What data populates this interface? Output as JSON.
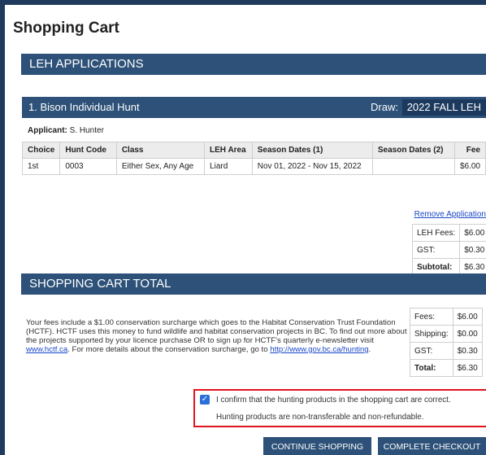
{
  "page": {
    "title": "Shopping Cart"
  },
  "leh_section": {
    "title": "LEH APPLICATIONS"
  },
  "hunt": {
    "name": "1. Bison Individual Hunt",
    "draw_label": "Draw:",
    "draw_value": "2022 FALL LEH",
    "applicant_label": "Applicant:",
    "applicant_name": "S. Hunter",
    "columns": [
      "Choice",
      "Hunt Code",
      "Class",
      "LEH Area",
      "Season Dates (1)",
      "Season Dates (2)",
      "Fee"
    ],
    "rows": [
      [
        "1st",
        "0003",
        "Either Sex, Any Age",
        "Liard",
        "Nov 01, 2022 - Nov 15, 2022",
        "",
        "$6.00"
      ]
    ],
    "remove_link": "Remove Application"
  },
  "leh_fees": [
    {
      "label": "LEH Fees:",
      "value": "$6.00"
    },
    {
      "label": "GST:",
      "value": "$0.30"
    },
    {
      "label": "Subtotal:",
      "value": "$6.30"
    }
  ],
  "total_section": {
    "title": "SHOPPING CART TOTAL"
  },
  "info": {
    "text_1": "Your fees include a $1.00 conservation surcharge which goes to the Habitat Conservation Trust Foundation (HCTF). HCTF uses this money to fund wildlife and habitat conservation projects in BC. To find out more about the projects supported by your licence purchase OR to sign up for HCTF's quarterly e-newsletter visit ",
    "link_1": "www.hctf.ca",
    "text_2": ". For more details about the conservation surcharge, go to ",
    "link_2": "http://www.gov.bc.ca/hunting",
    "text_3": "."
  },
  "total_fees": [
    {
      "label": "Fees:",
      "value": "$6.00"
    },
    {
      "label": "Shipping:",
      "value": "$0.00"
    },
    {
      "label": "GST:",
      "value": "$0.30"
    },
    {
      "label": "Total:",
      "value": "$6.30"
    }
  ],
  "confirm": {
    "checked": true,
    "text": "I confirm that the hunting products in the shopping cart are correct.",
    "note": "Hunting products are non-transferable and non-refundable."
  },
  "buttons": {
    "continue": "CONTINUE SHOPPING",
    "checkout": "COMPLETE CHECKOUT"
  },
  "colors": {
    "header_bar": "#2d5178",
    "frame": "#1f3a5c",
    "link": "#1a47c8",
    "highlight": "#e0141e"
  }
}
